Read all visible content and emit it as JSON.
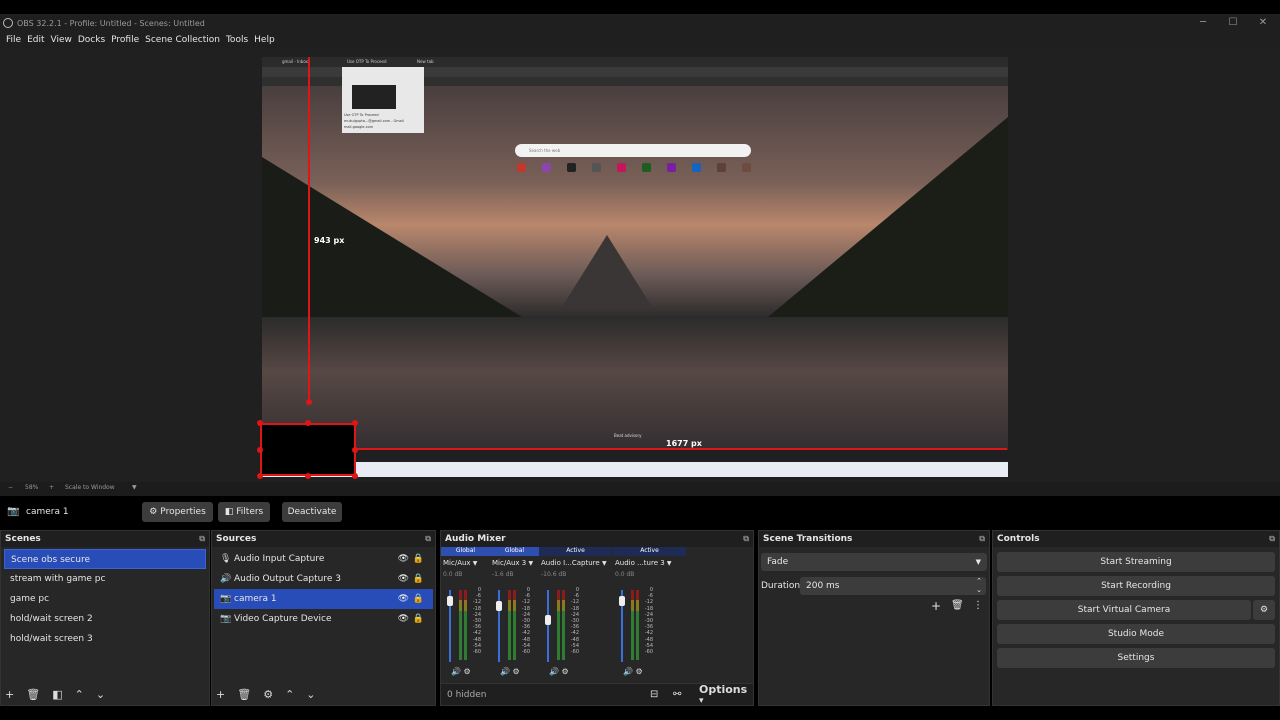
{
  "window": {
    "title": "OBS 32.2.1 - Profile: Untitled - Scenes: Untitled",
    "minimize_glyph": "─",
    "maximize_glyph": "☐",
    "close_glyph": "✕"
  },
  "menu": [
    "File",
    "Edit",
    "View",
    "Docks",
    "Profile",
    "Scene Collection",
    "Tools",
    "Help"
  ],
  "preview": {
    "vertical_measure": "943 px",
    "horizontal_measure": "1677 px",
    "search_placeholder": "Search the web",
    "safe_label": "Beat advisory",
    "tabs": [
      "gmail - Inbox",
      "Use OTP To Proceed",
      "New tab"
    ],
    "popup_title": "Use OTP To Proceed",
    "popup_email": "mukulgupta...@gmail.com - Gmail",
    "popup_url": "mail.google.com"
  },
  "statusbar": {
    "zoom_minus": "−",
    "zoom_value": "58%",
    "zoom_plus": "+",
    "scale_mode": "Scale to Window"
  },
  "toolbar": {
    "selected_source": "camera 1",
    "properties_label": "Properties",
    "filters_label": "Filters",
    "deactivate_label": "Deactivate"
  },
  "scenes": {
    "title": "Scenes",
    "items": [
      "Scene obs secure",
      "stream with game pc",
      "game pc",
      "hold/wait screen 2",
      "hold/wait screen 3"
    ],
    "selected_index": 0
  },
  "sources": {
    "title": "Sources",
    "items": [
      {
        "label": "Audio Input Capture",
        "icon": "microphone-icon"
      },
      {
        "label": "Audio Output Capture 3",
        "icon": "speaker-icon"
      },
      {
        "label": "camera 1",
        "icon": "camera-icon"
      },
      {
        "label": "Video Capture Device",
        "icon": "camera-icon"
      }
    ],
    "selected_index": 2
  },
  "mixer": {
    "title": "Audio Mixer",
    "channels": [
      {
        "tag": "Global",
        "name": "Mic/Aux",
        "db": "0.0 dB",
        "tag_color": "#2f4fb0",
        "fader": 0.9
      },
      {
        "tag": "Global",
        "name": "Mic/Aux 3",
        "db": "-1.6 dB",
        "tag_color": "#2f4fb0",
        "fader": 0.82
      },
      {
        "tag": "Active",
        "name": "Audio I...Capture",
        "db": "-10.6 dB",
        "tag_color": "#1d2b55",
        "fader": 0.6
      },
      {
        "tag": "Active",
        "name": "Audio ...ture 3",
        "db": "0.0 dB",
        "tag_color": "#1d2b55",
        "fader": 0.9
      }
    ],
    "scale": [
      "0",
      "-6",
      "-12",
      "-18",
      "-24",
      "-30",
      "-36",
      "-42",
      "-48",
      "-54",
      "-60"
    ],
    "hidden_label": "0 hidden",
    "options_label": "Options"
  },
  "transitions": {
    "title": "Scene Transitions",
    "selected": "Fade",
    "duration_label": "Duration",
    "duration_value": "200 ms"
  },
  "controls": {
    "title": "Controls",
    "start_streaming": "Start Streaming",
    "start_recording": "Start Recording",
    "start_virtual_camera": "Start Virtual Camera",
    "studio_mode": "Studio Mode",
    "settings": "Settings"
  },
  "colors": {
    "accent": "#284cb8",
    "guide_red": "#e01515",
    "meter_green": "#2e7d32",
    "meter_red": "#8a1c1c"
  }
}
